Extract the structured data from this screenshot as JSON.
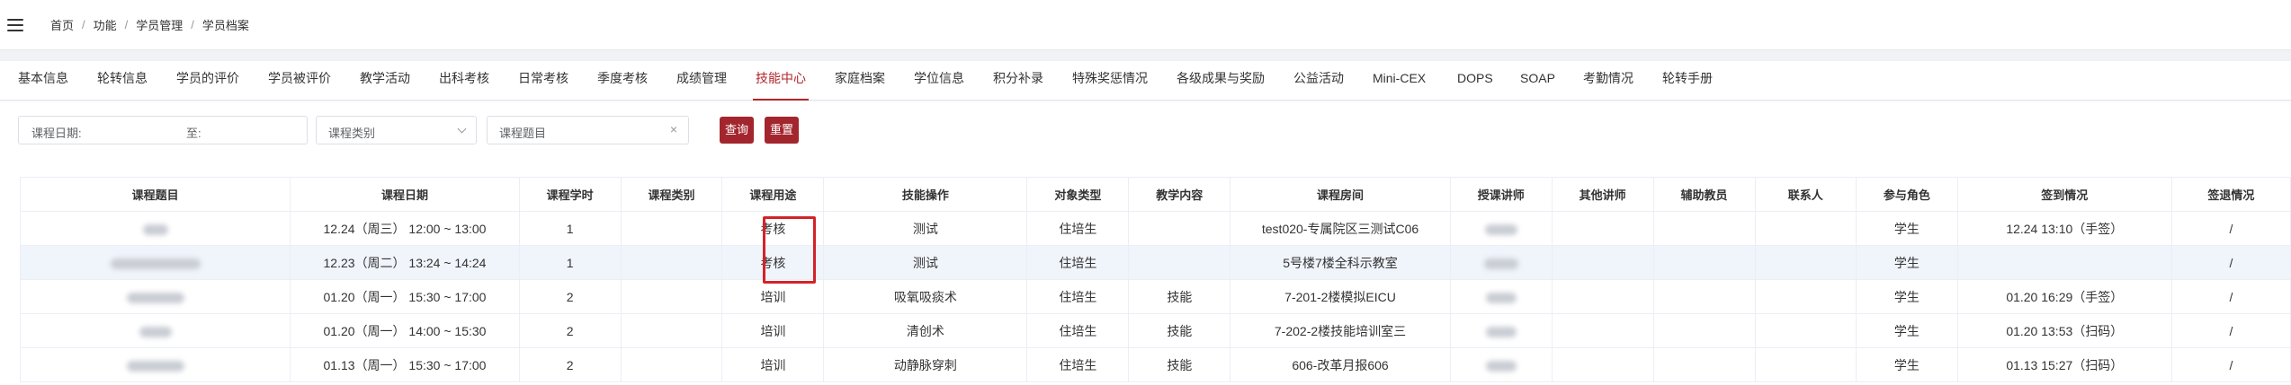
{
  "breadcrumb": [
    "首页",
    "功能",
    "学员管理",
    "学员档案"
  ],
  "tabs": [
    "基本信息",
    "轮转信息",
    "学员的评价",
    "学员被评价",
    "教学活动",
    "出科考核",
    "日常考核",
    "季度考核",
    "成绩管理",
    "技能中心",
    "家庭档案",
    "学位信息",
    "积分补录",
    "特殊奖惩情况",
    "各级成果与奖励",
    "公益活动",
    "Mini-CEX",
    "DOPS",
    "SOAP",
    "考勤情况",
    "轮转手册"
  ],
  "active_tab": "技能中心",
  "filters": {
    "date_label": "课程日期:",
    "date_to": "至:",
    "category_placeholder": "课程类别",
    "topic_placeholder": "课程题目",
    "clear_symbol": "×"
  },
  "buttons": {
    "query": "查询",
    "reset": "重置"
  },
  "table": {
    "headers": [
      "课程题目",
      "课程日期",
      "课程学时",
      "课程类别",
      "课程用途",
      "技能操作",
      "对象类型",
      "教学内容",
      "课程房间",
      "授课讲师",
      "其他讲师",
      "辅助教员",
      "联系人",
      "参与角色",
      "签到情况",
      "签退情况"
    ],
    "rows": [
      [
        "",
        "12.24（周三） 12:00 ~ 13:00",
        "1",
        "",
        "考核",
        "测试",
        "住培生",
        "",
        "test020-专属院区三测试C06",
        "",
        "",
        "",
        "",
        "学生",
        "12.24 13:10（手签）",
        "/"
      ],
      [
        "",
        "12.23（周二） 13:24 ~ 14:24",
        "1",
        "",
        "考核",
        "测试",
        "住培生",
        "",
        "5号楼7楼全科示教室",
        "",
        "",
        "",
        "",
        "学生",
        "",
        "/"
      ],
      [
        "",
        "01.20（周一） 15:30 ~ 17:00",
        "2",
        "",
        "培训",
        "吸氧吸痰术",
        "住培生",
        "技能",
        "7-201-2楼模拟EICU",
        "",
        "",
        "",
        "",
        "学生",
        "01.20 16:29（手签）",
        "/"
      ],
      [
        "",
        "01.20（周一） 14:00 ~ 15:30",
        "2",
        "",
        "培训",
        "清创术",
        "住培生",
        "技能",
        "7-202-2楼技能培训室三",
        "",
        "",
        "",
        "",
        "学生",
        "01.20 13:53（扫码）",
        "/"
      ],
      [
        "",
        "01.13（周一） 15:30 ~ 17:00",
        "2",
        "",
        "培训",
        "动静脉穿刺",
        "住培生",
        "技能",
        "606-改革月报606",
        "",
        "",
        "",
        "",
        "学生",
        "01.13 15:27（扫码）",
        "/"
      ]
    ]
  },
  "colors": {
    "accent": "#b3262d",
    "button": "#a3262e",
    "highlight_box": "#d3222a",
    "row_highlight": "#f0f4fb"
  }
}
